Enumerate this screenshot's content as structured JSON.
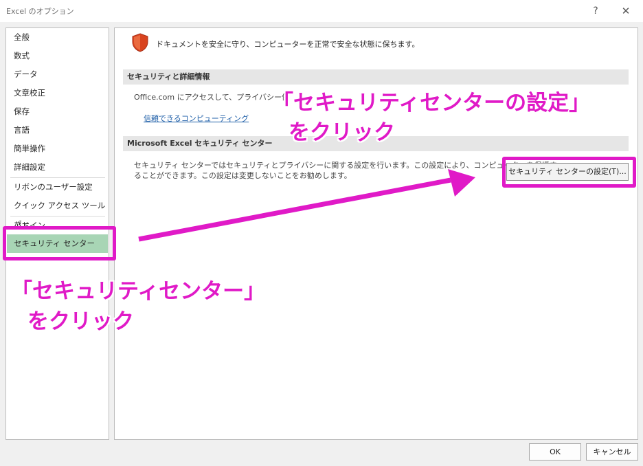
{
  "window": {
    "title": "Excel のオプション",
    "help_glyph": "?",
    "close_glyph": "✕"
  },
  "sidebar": {
    "items": [
      {
        "label": "全般"
      },
      {
        "label": "数式"
      },
      {
        "label": "データ"
      },
      {
        "label": "文章校正"
      },
      {
        "label": "保存"
      },
      {
        "label": "言語"
      },
      {
        "label": "簡単操作"
      },
      {
        "label": "詳細設定"
      },
      {
        "label": "リボンのユーザー設定"
      },
      {
        "label": "クイック アクセス ツール バー"
      },
      {
        "label": "アドイン"
      },
      {
        "label": "セキュリティ センター",
        "selected": true
      }
    ]
  },
  "main": {
    "intro": "ドキュメントを安全に守り、コンピューターを正常で安全な状態に保ちます。",
    "section1": {
      "heading": "セキュリティと詳細情報",
      "text": "Office.com にアクセスして、プライバシー保",
      "link": "信頼できるコンピューティング"
    },
    "section2": {
      "heading": "Microsoft Excel セキュリティ センター",
      "text_line1": "セキュリティ センターではセキュリティとプライバシーに関する設定を行います。この設定により、コンピューターを保護す",
      "text_line2": "ることができます。この設定は変更しないことをお勧めします。",
      "button": "セキュリティ センターの設定(T)..."
    }
  },
  "footer": {
    "ok": "OK",
    "cancel": "キャンセル"
  },
  "annotations": {
    "callout_top_line1": "「セキュリティセンターの設定」",
    "callout_top_line2": "をクリック",
    "callout_left_line1": "「セキュリティセンター」",
    "callout_left_line2": "をクリック",
    "color": "#e01ac7"
  },
  "colors": {
    "selected_nav": "#a8d5b5",
    "shield": "#d9431e",
    "link": "#1f5fa8"
  }
}
